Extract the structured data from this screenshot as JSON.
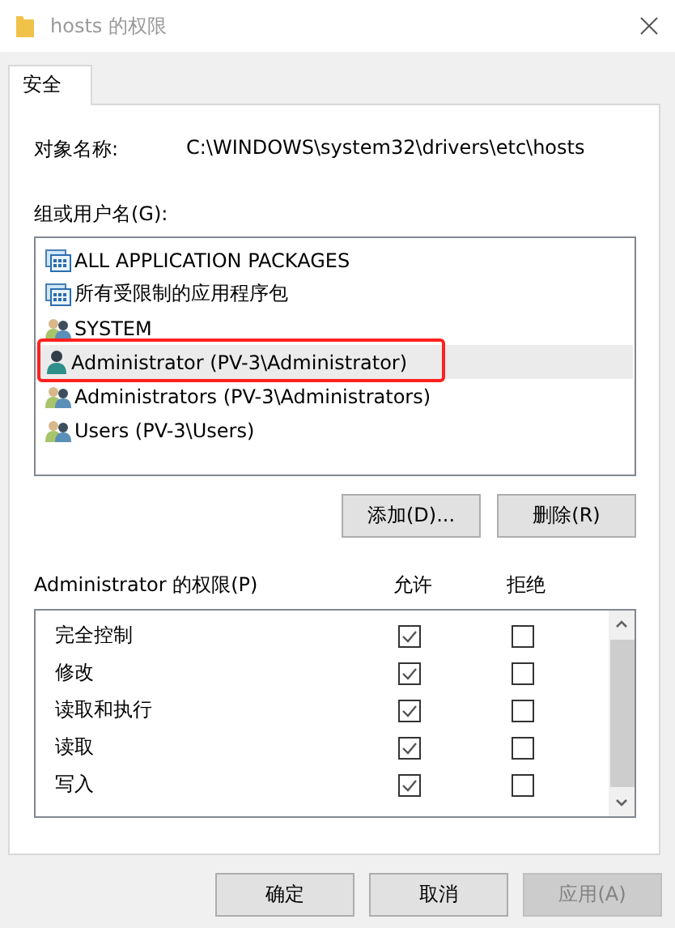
{
  "window": {
    "title": "hosts 的权限"
  },
  "tabs": [
    {
      "label": "安全",
      "selected": true
    }
  ],
  "object_name": {
    "label": "对象名称:",
    "value": "C:\\WINDOWS\\system32\\drivers\\etc\\hosts"
  },
  "principals": {
    "label": "组或用户名(G):",
    "items": [
      {
        "kind": "package",
        "name": "ALL APPLICATION PACKAGES",
        "selected": false,
        "outlined": false
      },
      {
        "kind": "package",
        "name": "所有受限制的应用程序包",
        "selected": false,
        "outlined": false
      },
      {
        "kind": "group",
        "name": "SYSTEM",
        "selected": false,
        "outlined": false
      },
      {
        "kind": "user",
        "name": "Administrator (PV-3\\Administrator)",
        "selected": true,
        "outlined": true
      },
      {
        "kind": "group",
        "name": "Administrators (PV-3\\Administrators)",
        "selected": false,
        "outlined": false
      },
      {
        "kind": "group",
        "name": "Users (PV-3\\Users)",
        "selected": false,
        "outlined": false
      }
    ],
    "buttons": [
      "添加(D)...",
      "删除(R)"
    ]
  },
  "permissions": {
    "label": "Administrator 的权限(P)",
    "allow_header": "允许",
    "deny_header": "拒绝",
    "rows": [
      {
        "name": "完全控制",
        "allow": true,
        "deny": false
      },
      {
        "name": "修改",
        "allow": true,
        "deny": false
      },
      {
        "name": "读取和执行",
        "allow": true,
        "deny": false
      },
      {
        "name": "读取",
        "allow": true,
        "deny": false
      },
      {
        "name": "写入",
        "allow": true,
        "deny": false
      }
    ]
  },
  "buttons": [
    {
      "label": "确定",
      "disabled": false
    },
    {
      "label": "取消",
      "disabled": false
    },
    {
      "label": "应用(A)",
      "disabled": true
    }
  ]
}
